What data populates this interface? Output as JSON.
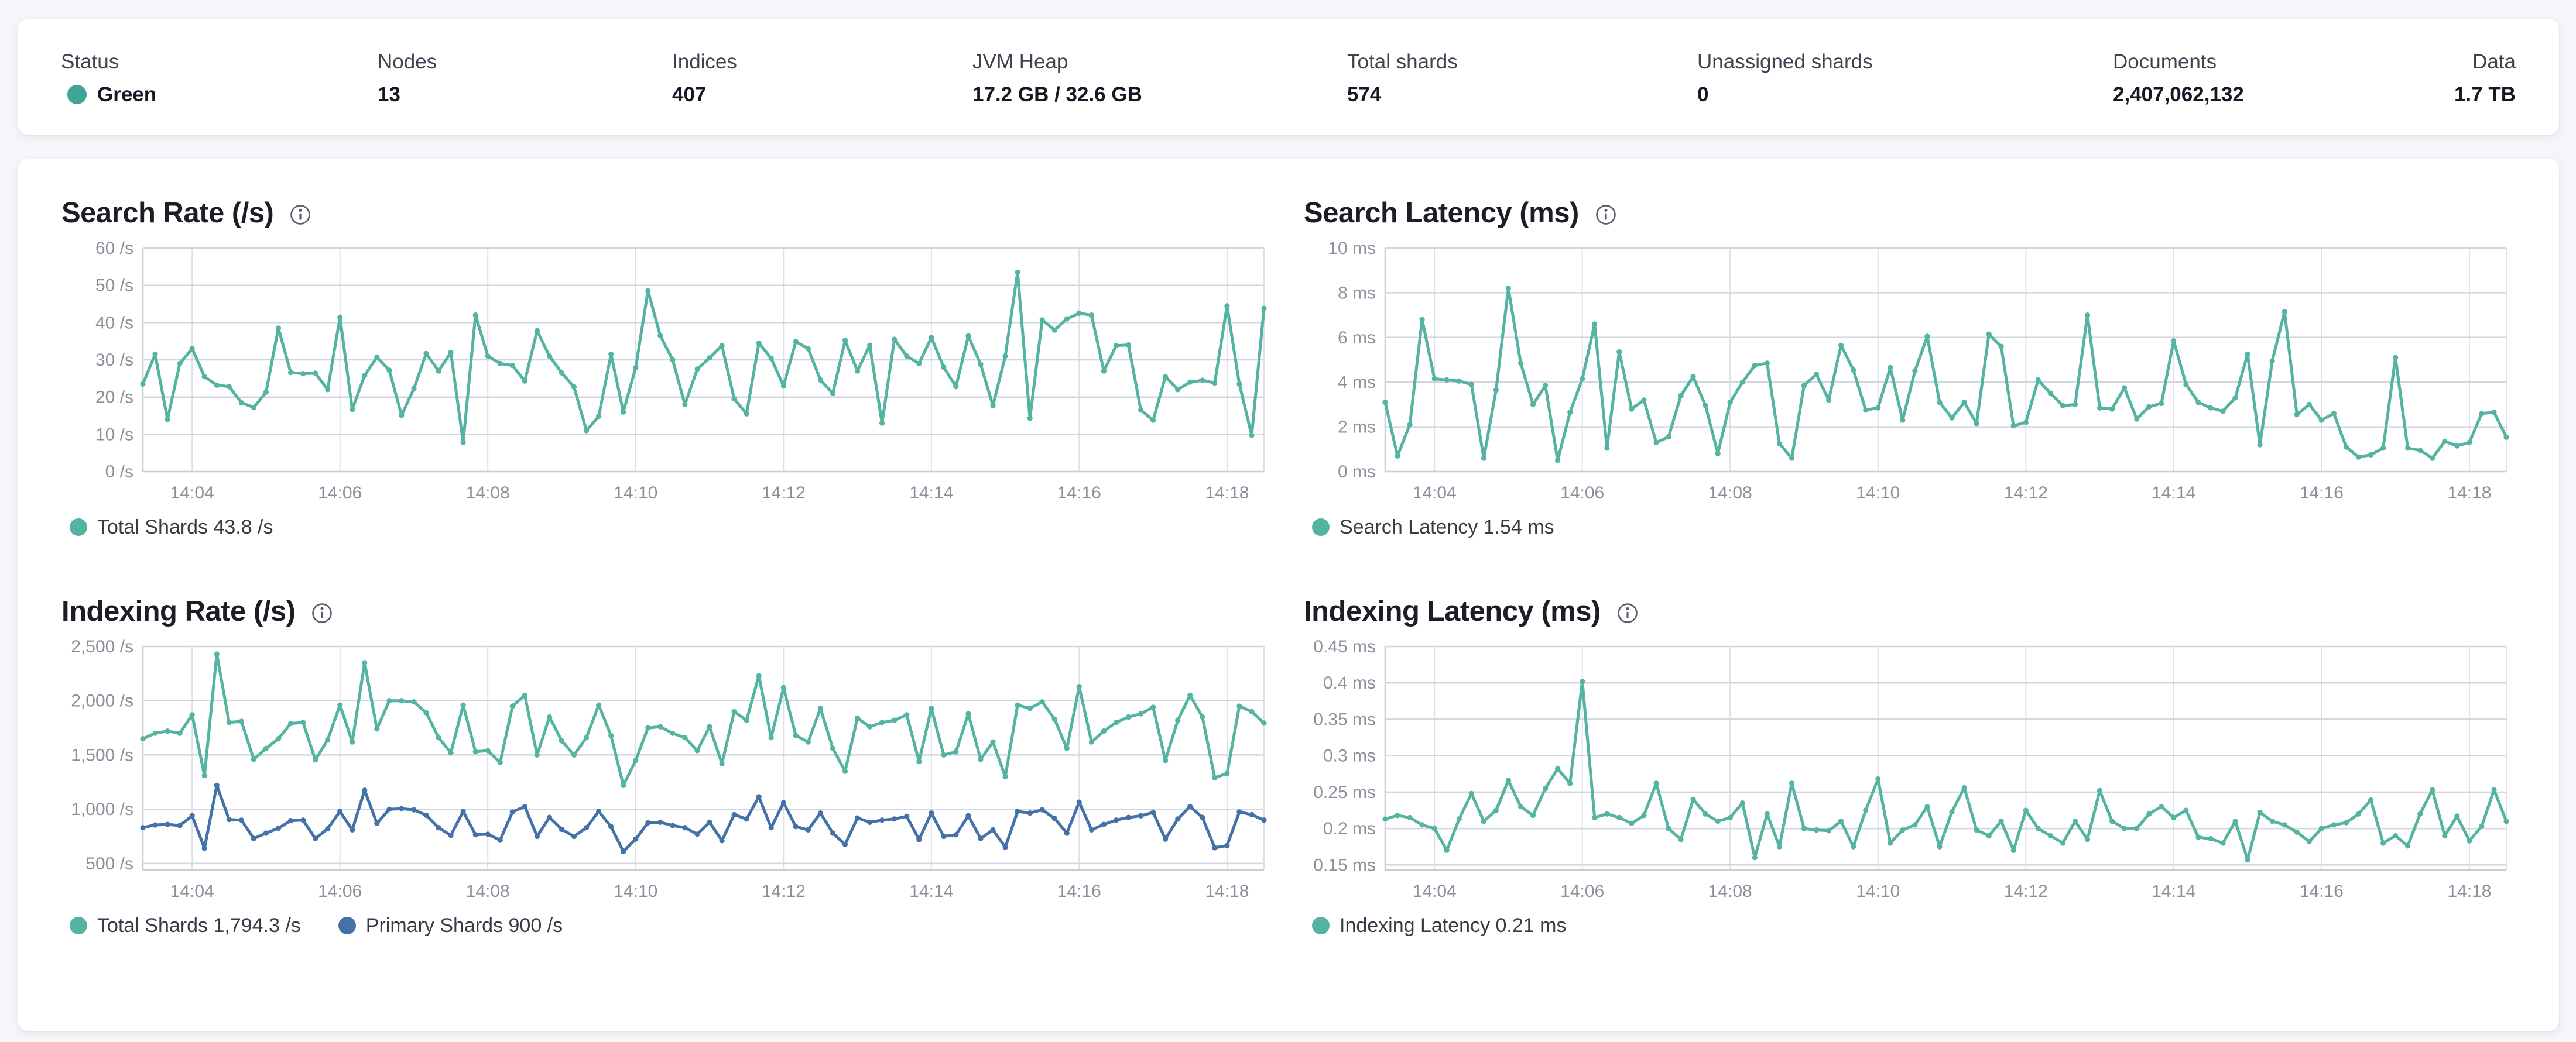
{
  "header": {
    "metrics": [
      {
        "label": "Status",
        "value": "Green",
        "type": "status",
        "dot_color": "#3fa493"
      },
      {
        "label": "Nodes",
        "value": "13"
      },
      {
        "label": "Indices",
        "value": "407"
      },
      {
        "label": "JVM Heap",
        "value": "17.2 GB / 32.6 GB"
      },
      {
        "label": "Total shards",
        "value": "574"
      },
      {
        "label": "Unassigned shards",
        "value": "0"
      },
      {
        "label": "Documents",
        "value": "2,407,062,132"
      },
      {
        "label": "Data",
        "value": "1.7 TB"
      }
    ]
  },
  "colors": {
    "page_background": "#f4f6f9",
    "card_background": "#ffffff",
    "teal_series": "#55b3a1",
    "blue_series": "#4472a8",
    "status_green": "#3fa493",
    "grid_horizontal": "#d2d6de",
    "grid_vertical": "#dde0e6",
    "axis_line": "#c9ced6",
    "tick_text": "#8b919c"
  },
  "chart_data": [
    {
      "type": "line",
      "title": "Search Rate (/s)",
      "info_icon": "i-in-circle",
      "ylim": [
        0,
        60
      ],
      "y_ticks": [
        {
          "v": 60,
          "label": "60 /s"
        },
        {
          "v": 50,
          "label": "50 /s"
        },
        {
          "v": 40,
          "label": "40 /s"
        },
        {
          "v": 30,
          "label": "30 /s"
        },
        {
          "v": 20,
          "label": "20 /s"
        },
        {
          "v": 10,
          "label": "10 /s"
        },
        {
          "v": 0,
          "label": "0 /s"
        }
      ],
      "x_tick_labels": [
        "14:04",
        "14:06",
        "14:08",
        "14:10",
        "14:12",
        "14:14",
        "14:16",
        "14:18"
      ],
      "x_tick_indices": [
        4,
        16,
        28,
        40,
        52,
        64,
        76,
        88
      ],
      "legend": [
        {
          "name": "Total Shards",
          "value_label": "Total Shards 43.8 /s",
          "color": "#55b3a1"
        }
      ],
      "series": [
        {
          "name": "Total Shards",
          "color": "#55b3a1",
          "values": [
            23.5,
            31.5,
            14.0,
            29.0,
            33.0,
            25.5,
            23.2,
            22.8,
            18.5,
            17.2,
            21.3,
            38.5,
            26.6,
            26.3,
            26.4,
            22.0,
            41.4,
            16.7,
            25.8,
            30.7,
            27.2,
            15.1,
            22.3,
            31.7,
            27.0,
            32.0,
            7.8,
            42.0,
            31.0,
            29.0,
            28.5,
            24.3,
            37.8,
            31.0,
            26.5,
            22.7,
            11.0,
            14.8,
            31.5,
            16.0,
            27.9,
            48.5,
            36.5,
            30.0,
            18.0,
            27.5,
            30.5,
            33.8,
            19.5,
            15.5,
            34.5,
            30.4,
            23.0,
            34.9,
            33.0,
            24.6,
            21.0,
            35.2,
            27.0,
            33.9,
            13.0,
            35.5,
            31.0,
            29.0,
            36.0,
            28.0,
            22.8,
            36.4,
            28.8,
            17.7,
            31.0,
            53.5,
            14.3,
            40.7,
            38.0,
            41.0,
            42.5,
            42.0,
            27.0,
            33.8,
            34.0,
            16.5,
            13.8,
            25.5,
            22.0,
            24.0,
            24.5,
            23.8,
            44.5,
            23.5,
            9.7,
            43.8
          ]
        }
      ]
    },
    {
      "type": "line",
      "title": "Search Latency (ms)",
      "info_icon": "i-in-circle",
      "ylim": [
        0,
        10
      ],
      "y_ticks": [
        {
          "v": 10,
          "label": "10 ms"
        },
        {
          "v": 8,
          "label": "8 ms"
        },
        {
          "v": 6,
          "label": "6 ms"
        },
        {
          "v": 4,
          "label": "4 ms"
        },
        {
          "v": 2,
          "label": "2 ms"
        },
        {
          "v": 0,
          "label": "0 ms"
        }
      ],
      "x_tick_labels": [
        "14:04",
        "14:06",
        "14:08",
        "14:10",
        "14:12",
        "14:14",
        "14:16",
        "14:18"
      ],
      "x_tick_indices": [
        4,
        16,
        28,
        40,
        52,
        64,
        76,
        88
      ],
      "legend": [
        {
          "name": "Search Latency",
          "value_label": "Search Latency 1.54 ms",
          "color": "#55b3a1"
        }
      ],
      "series": [
        {
          "name": "Search Latency",
          "color": "#55b3a1",
          "values": [
            3.1,
            0.7,
            2.1,
            6.8,
            4.15,
            4.1,
            4.05,
            3.9,
            0.6,
            3.65,
            8.2,
            4.85,
            3.0,
            3.85,
            0.5,
            2.65,
            4.15,
            6.6,
            1.05,
            5.35,
            2.8,
            3.2,
            1.3,
            1.55,
            3.4,
            4.25,
            2.95,
            0.8,
            3.1,
            4.0,
            4.75,
            4.85,
            1.25,
            0.6,
            3.85,
            4.35,
            3.2,
            5.65,
            4.55,
            2.75,
            2.85,
            4.65,
            2.3,
            4.5,
            6.05,
            3.1,
            2.4,
            3.1,
            2.15,
            6.15,
            5.6,
            2.05,
            2.2,
            4.1,
            3.5,
            2.95,
            3.0,
            7.0,
            2.85,
            2.8,
            3.75,
            2.35,
            2.9,
            3.05,
            5.85,
            3.9,
            3.1,
            2.85,
            2.7,
            3.3,
            5.25,
            1.2,
            4.95,
            7.15,
            2.55,
            3.0,
            2.3,
            2.6,
            1.1,
            0.65,
            0.75,
            1.05,
            5.1,
            1.05,
            0.95,
            0.6,
            1.35,
            1.15,
            1.3,
            2.6,
            2.65,
            1.54
          ]
        }
      ]
    },
    {
      "type": "line",
      "title": "Indexing Rate (/s)",
      "info_icon": "i-in-circle",
      "ylim": [
        440,
        2500
      ],
      "y_ticks": [
        {
          "v": 2500,
          "label": "2,500 /s"
        },
        {
          "v": 2000,
          "label": "2,000 /s"
        },
        {
          "v": 1500,
          "label": "1,500 /s"
        },
        {
          "v": 1000,
          "label": "1,000 /s"
        },
        {
          "v": 500,
          "label": "500 /s"
        }
      ],
      "x_tick_labels": [
        "14:04",
        "14:06",
        "14:08",
        "14:10",
        "14:12",
        "14:14",
        "14:16",
        "14:18"
      ],
      "x_tick_indices": [
        4,
        16,
        28,
        40,
        52,
        64,
        76,
        88
      ],
      "legend": [
        {
          "name": "Total Shards",
          "value_label": "Total Shards 1,794.3 /s",
          "color": "#55b3a1"
        },
        {
          "name": "Primary Shards",
          "value_label": "Primary Shards 900 /s",
          "color": "#4472a8"
        }
      ],
      "series": [
        {
          "name": "Total Shards",
          "color": "#55b3a1",
          "values": [
            1650,
            1700,
            1720,
            1700,
            1870,
            1310,
            2430,
            1800,
            1810,
            1460,
            1560,
            1650,
            1790,
            1800,
            1455,
            1640,
            1960,
            1620,
            2350,
            1740,
            2000,
            2000,
            1990,
            1890,
            1660,
            1520,
            1960,
            1530,
            1540,
            1430,
            1950,
            2050,
            1500,
            1850,
            1630,
            1500,
            1660,
            1960,
            1680,
            1220,
            1450,
            1750,
            1760,
            1700,
            1660,
            1540,
            1760,
            1420,
            1900,
            1820,
            2230,
            1660,
            2120,
            1680,
            1620,
            1930,
            1560,
            1350,
            1840,
            1760,
            1800,
            1820,
            1870,
            1440,
            1930,
            1500,
            1530,
            1880,
            1460,
            1620,
            1300,
            1960,
            1930,
            1990,
            1830,
            1560,
            2130,
            1620,
            1720,
            1800,
            1850,
            1880,
            1940,
            1450,
            1820,
            2050,
            1850,
            1290,
            1330,
            1950,
            1900,
            1794.3
          ]
        },
        {
          "name": "Primary Shards",
          "color": "#4472a8",
          "values": [
            830,
            855,
            860,
            850,
            940,
            640,
            1220,
            905,
            900,
            730,
            780,
            825,
            895,
            900,
            730,
            820,
            980,
            810,
            1175,
            870,
            1000,
            1005,
            995,
            945,
            830,
            760,
            980,
            765,
            770,
            715,
            975,
            1025,
            750,
            925,
            815,
            750,
            830,
            980,
            840,
            610,
            725,
            875,
            880,
            850,
            830,
            770,
            880,
            710,
            950,
            910,
            1115,
            830,
            1060,
            840,
            810,
            965,
            780,
            675,
            920,
            880,
            900,
            910,
            935,
            720,
            965,
            750,
            765,
            940,
            730,
            810,
            650,
            980,
            965,
            995,
            915,
            780,
            1065,
            810,
            860,
            900,
            925,
            940,
            970,
            725,
            910,
            1025,
            925,
            645,
            665,
            975,
            950,
            900
          ]
        }
      ]
    },
    {
      "type": "line",
      "title": "Indexing Latency (ms)",
      "info_icon": "i-in-circle",
      "ylim": [
        0.143,
        0.45
      ],
      "y_ticks": [
        {
          "v": 0.45,
          "label": "0.45 ms"
        },
        {
          "v": 0.4,
          "label": "0.4 ms"
        },
        {
          "v": 0.35,
          "label": "0.35 ms"
        },
        {
          "v": 0.3,
          "label": "0.3 ms"
        },
        {
          "v": 0.25,
          "label": "0.25 ms"
        },
        {
          "v": 0.2,
          "label": "0.2 ms"
        },
        {
          "v": 0.15,
          "label": "0.15 ms"
        }
      ],
      "x_tick_labels": [
        "14:04",
        "14:06",
        "14:08",
        "14:10",
        "14:12",
        "14:14",
        "14:16",
        "14:18"
      ],
      "x_tick_indices": [
        4,
        16,
        28,
        40,
        52,
        64,
        76,
        88
      ],
      "legend": [
        {
          "name": "Indexing Latency",
          "value_label": "Indexing Latency 0.21 ms",
          "color": "#55b3a1"
        }
      ],
      "series": [
        {
          "name": "Indexing Latency",
          "color": "#55b3a1",
          "values": [
            0.213,
            0.218,
            0.215,
            0.205,
            0.2,
            0.17,
            0.213,
            0.248,
            0.21,
            0.225,
            0.266,
            0.23,
            0.218,
            0.255,
            0.282,
            0.262,
            0.402,
            0.215,
            0.22,
            0.215,
            0.207,
            0.218,
            0.262,
            0.2,
            0.185,
            0.24,
            0.22,
            0.21,
            0.215,
            0.235,
            0.16,
            0.22,
            0.175,
            0.262,
            0.2,
            0.198,
            0.197,
            0.21,
            0.175,
            0.225,
            0.268,
            0.18,
            0.198,
            0.205,
            0.23,
            0.175,
            0.223,
            0.256,
            0.198,
            0.19,
            0.21,
            0.17,
            0.225,
            0.2,
            0.19,
            0.18,
            0.21,
            0.185,
            0.252,
            0.21,
            0.2,
            0.2,
            0.22,
            0.23,
            0.215,
            0.225,
            0.188,
            0.186,
            0.18,
            0.21,
            0.157,
            0.222,
            0.21,
            0.205,
            0.195,
            0.182,
            0.2,
            0.205,
            0.208,
            0.22,
            0.239,
            0.18,
            0.19,
            0.176,
            0.22,
            0.253,
            0.19,
            0.217,
            0.183,
            0.203,
            0.253,
            0.21
          ]
        }
      ]
    }
  ]
}
